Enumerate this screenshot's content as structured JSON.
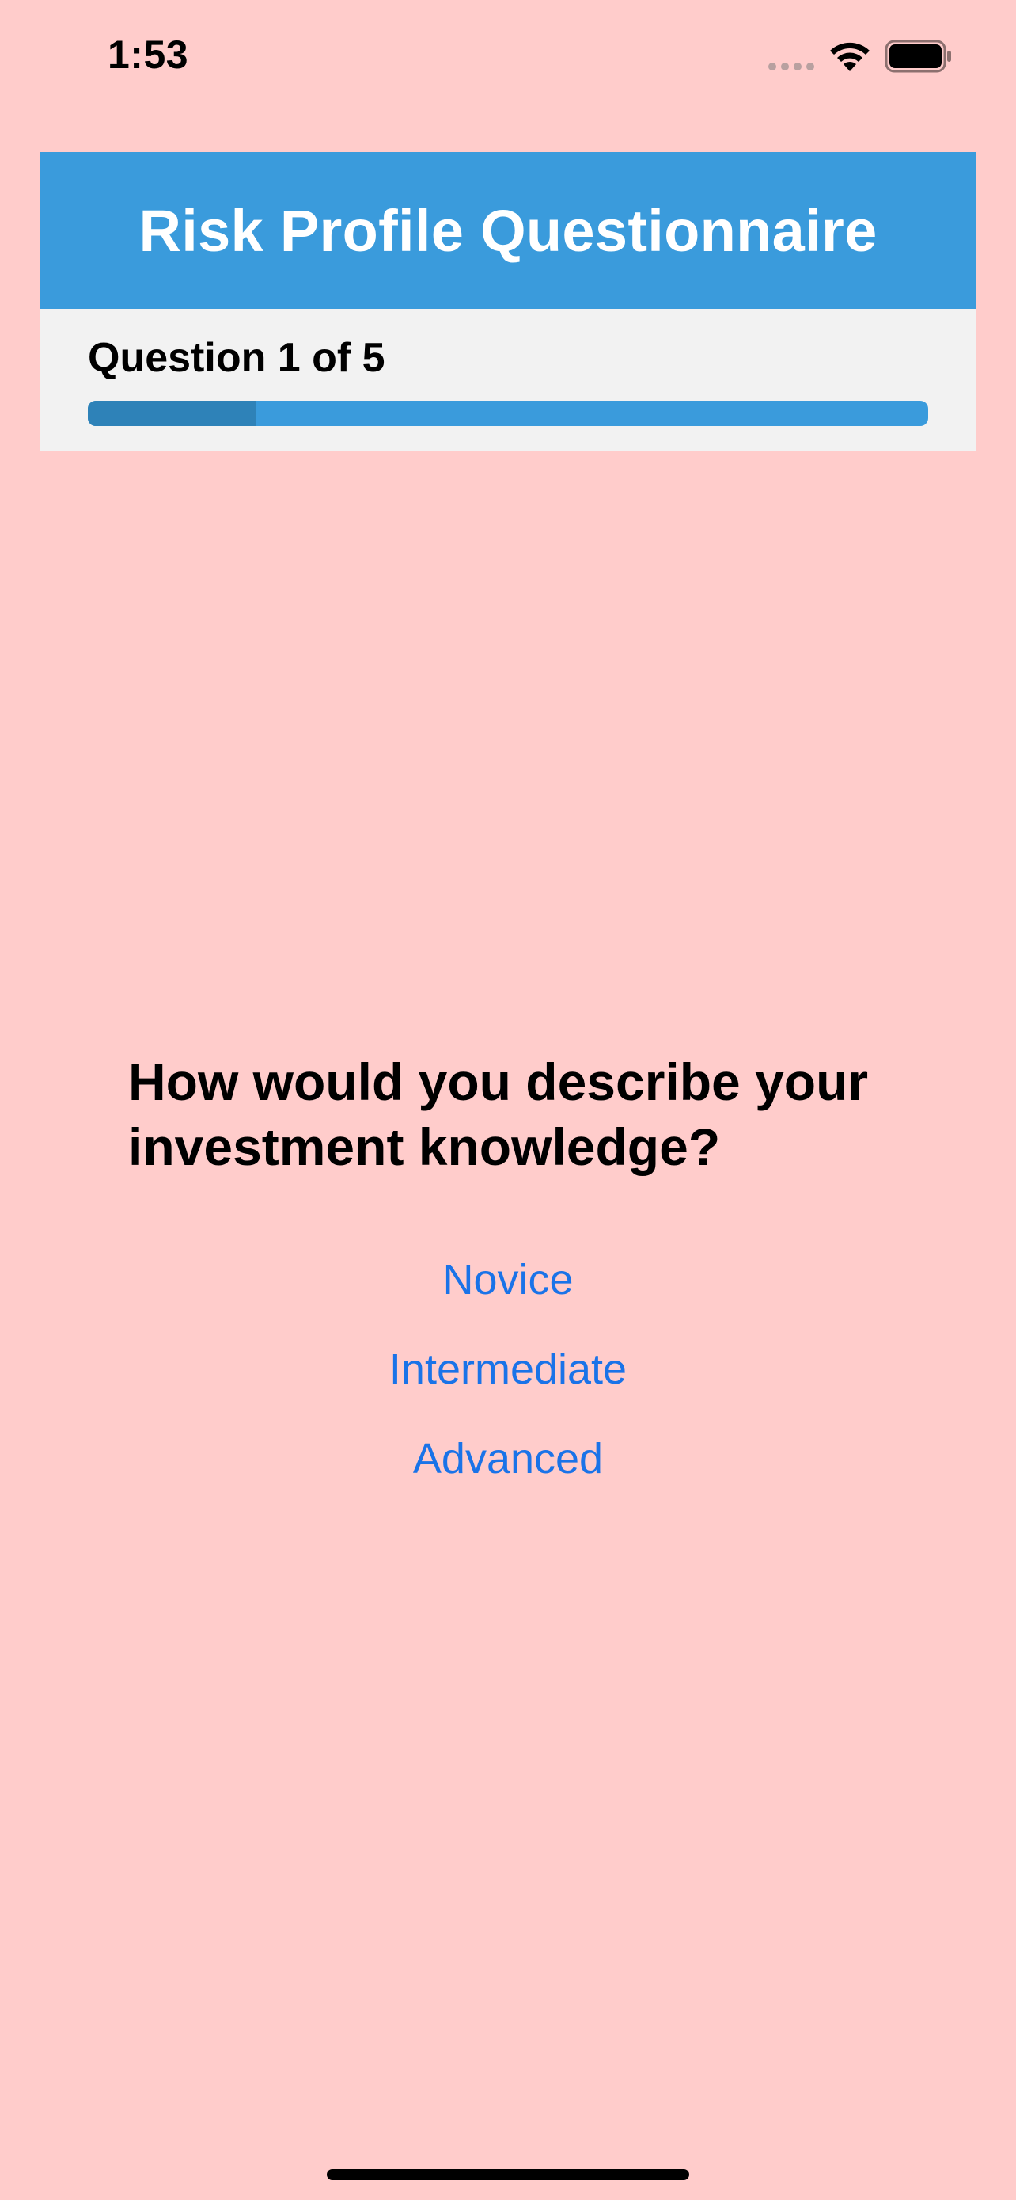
{
  "status_bar": {
    "time": "1:53"
  },
  "header": {
    "title": "Risk Profile Questionnaire"
  },
  "progress": {
    "label": "Question 1 of 5",
    "current": 1,
    "total": 5,
    "fraction": 0.2
  },
  "question": {
    "text": "How would you describe your investment knowledge?"
  },
  "options": [
    {
      "label": "Novice"
    },
    {
      "label": "Intermediate"
    },
    {
      "label": "Advanced"
    }
  ],
  "colors": {
    "background": "#ffcccb",
    "header": "#3a9bdc",
    "progress_fill": "#2e82b8",
    "option_text": "#1a73e8"
  }
}
